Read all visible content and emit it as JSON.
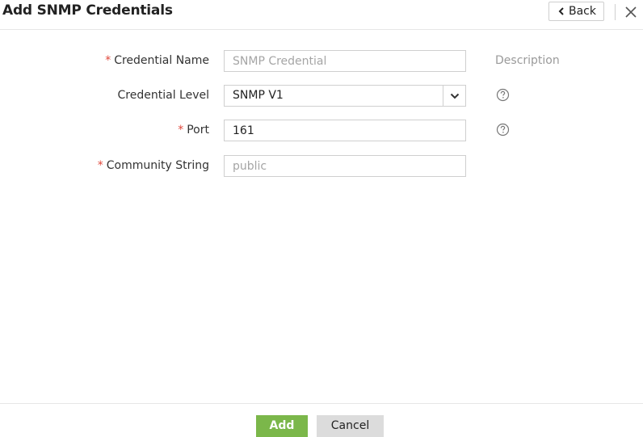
{
  "header": {
    "title": "Add SNMP Credentials",
    "back_label": "Back"
  },
  "form": {
    "required_mark": "*",
    "credential_name": {
      "label": "Credential Name",
      "placeholder": "SNMP Credential",
      "aux": "Description"
    },
    "credential_level": {
      "label": "Credential Level",
      "value": "SNMP V1"
    },
    "port": {
      "label": "Port",
      "value": "161"
    },
    "community_string": {
      "label": "Community String",
      "placeholder": "public"
    }
  },
  "footer": {
    "add_label": "Add",
    "cancel_label": "Cancel"
  },
  "colors": {
    "accent_green": "#7bb74a",
    "required_red": "#e0463a"
  }
}
